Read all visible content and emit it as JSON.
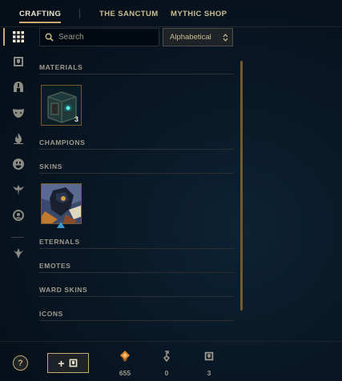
{
  "nav": {
    "tabs": [
      {
        "label": "CRAFTING",
        "active": true
      },
      {
        "label": "THE SANCTUM",
        "active": false
      },
      {
        "label": "MYTHIC SHOP",
        "active": false
      }
    ]
  },
  "sidebar": {
    "items": [
      {
        "icon": "grid-icon",
        "active": true
      },
      {
        "icon": "chest-icon",
        "active": false
      },
      {
        "icon": "helmet-icon",
        "active": false
      },
      {
        "icon": "mask-icon",
        "active": false
      },
      {
        "icon": "fire-icon",
        "active": false
      },
      {
        "icon": "emote-face-icon",
        "active": false
      },
      {
        "icon": "ward-icon",
        "active": false
      },
      {
        "icon": "profile-icon",
        "active": false
      },
      {
        "icon": "arrow-down-icon",
        "active": false
      }
    ]
  },
  "search": {
    "placeholder": "Search",
    "value": ""
  },
  "sort": {
    "selected": "Alphabetical"
  },
  "sections": {
    "materials": {
      "title": "MATERIALS",
      "items": [
        {
          "name": "hextech-chest",
          "count": "3"
        }
      ]
    },
    "champions": {
      "title": "CHAMPIONS"
    },
    "skins": {
      "title": "SKINS",
      "items": [
        {
          "name": "skin-shard"
        }
      ]
    },
    "eternals": {
      "title": "ETERNALS"
    },
    "emotes": {
      "title": "EMOTES"
    },
    "ward_skins": {
      "title": "WARD SKINS"
    },
    "icons": {
      "title": "ICONS"
    }
  },
  "footer": {
    "help_label": "?",
    "add_label": "+",
    "currencies": [
      {
        "icon": "orange-essence-icon",
        "value": "655"
      },
      {
        "icon": "key-icon",
        "value": "0"
      },
      {
        "icon": "chest-icon",
        "value": "3"
      }
    ]
  },
  "colors": {
    "gold": "#c8aa6e",
    "background": "#081522",
    "orange_essence": "#d8852e"
  }
}
